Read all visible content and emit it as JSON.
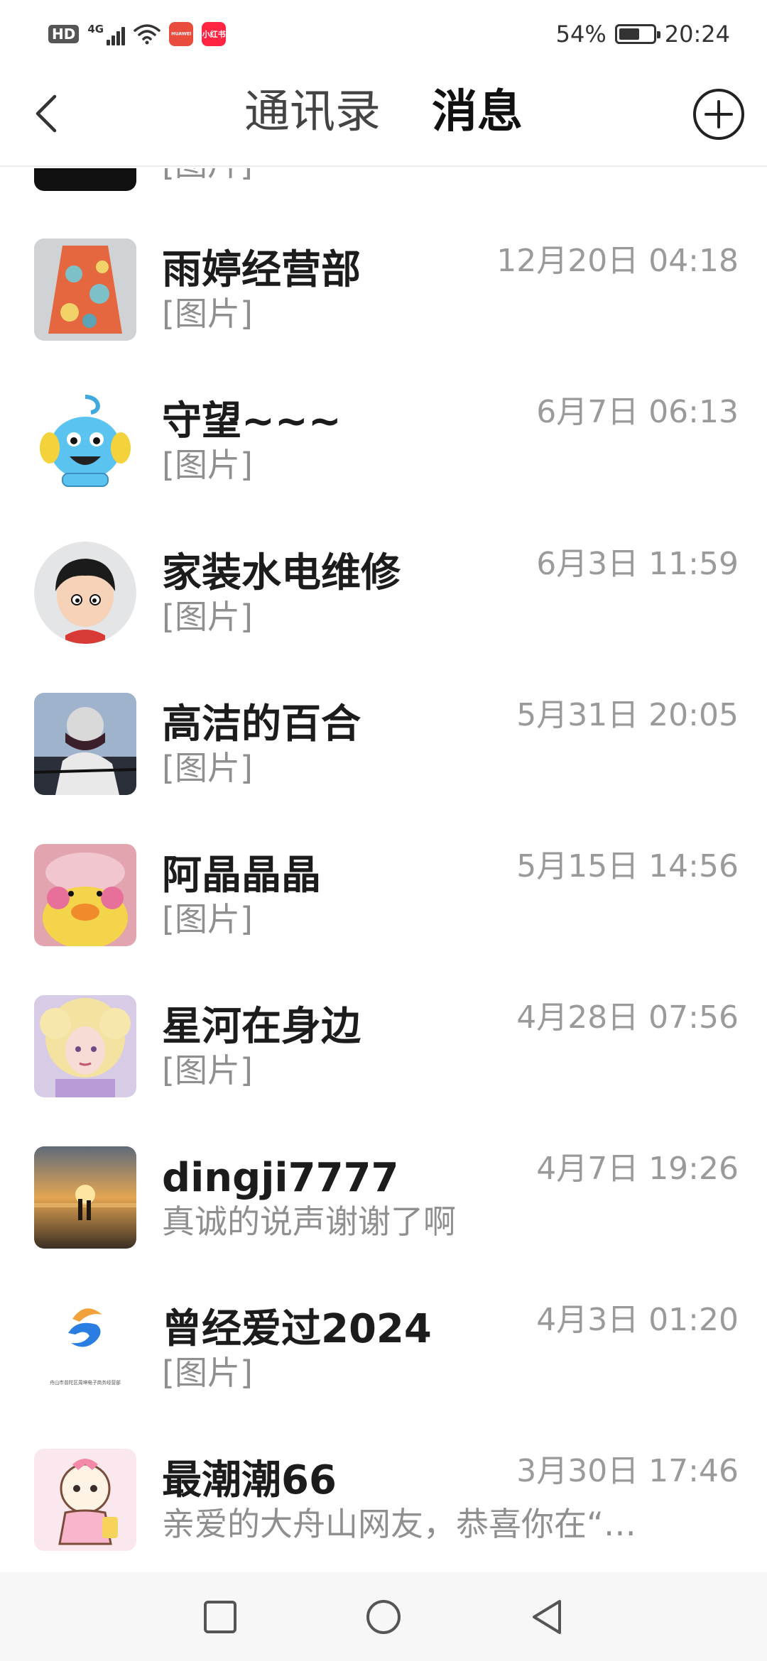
{
  "status_bar": {
    "hd": "HD",
    "network": "4G",
    "app1": "HUAWEI",
    "app2": "小红书",
    "battery": "54%",
    "time": "20:24",
    "app1_color": "#e94b3c",
    "app2_color": "#ff2442"
  },
  "header": {
    "tab_contacts": "通讯录",
    "tab_messages": "消息"
  },
  "messages": [
    {
      "name": "",
      "preview": "[图片]",
      "time": ""
    },
    {
      "name": "雨婷经营部",
      "preview": "[图片]",
      "time": "12月20日 04:18"
    },
    {
      "name": "守望~~~",
      "preview": "[图片]",
      "time": "6月7日 06:13"
    },
    {
      "name": "家装水电维修",
      "preview": "[图片]",
      "time": "6月3日 11:59"
    },
    {
      "name": "高洁的百合",
      "preview": "[图片]",
      "time": "5月31日 20:05"
    },
    {
      "name": "阿晶晶晶",
      "preview": "[图片]",
      "time": "5月15日 14:56"
    },
    {
      "name": "星河在身边",
      "preview": "[图片]",
      "time": "4月28日 07:56"
    },
    {
      "name": "dingji7777",
      "preview": "真诚的说声谢谢了啊",
      "time": "4月7日 19:26"
    },
    {
      "name": "曾经爱过2024",
      "preview": "[图片]",
      "time": "4月3日 01:20",
      "avatar_caption": "舟山市普陀区周坤电子商务经营部"
    },
    {
      "name": "最潮潮66",
      "preview": "亲爱的大舟山网友，恭喜你在“…",
      "time": "3月30日 17:46"
    }
  ],
  "icons": {
    "back": "chevron-left-icon",
    "add": "plus-circle-icon",
    "nav_recent": "square-icon",
    "nav_home": "circle-icon",
    "nav_back": "triangle-back-icon"
  }
}
